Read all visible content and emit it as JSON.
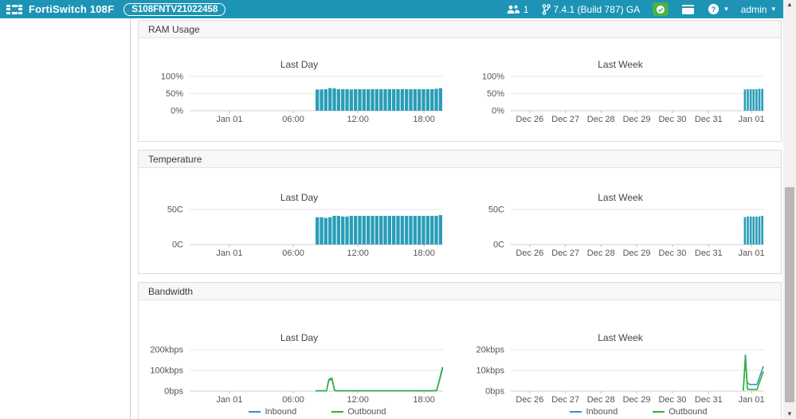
{
  "header": {
    "product": "FortiSwitch 108F",
    "serial": "S108FNTV21022458",
    "user_count": "1",
    "version": "7.4.1 (Build 787) GA",
    "admin_label": "admin",
    "colors": {
      "navbar_bg": "#1d94b6",
      "status_badge_bg": "#4db04a"
    }
  },
  "panels": [
    {
      "title": "RAM Usage"
    },
    {
      "title": "Temperature"
    },
    {
      "title": "Bandwidth"
    }
  ],
  "colors": {
    "bar_fill": "#2a9db8",
    "gridline": "#e7e7e7",
    "axis": "#cfcfcf",
    "tick": "#bbbbbb",
    "tick_text": "#555555",
    "inbound": "#2997cc",
    "outbound": "#2eb42e"
  },
  "chart_data": [
    {
      "id": "ram-day",
      "panel": "RAM Usage",
      "type": "bar",
      "title": "Last Day",
      "ylim": [
        0,
        100
      ],
      "y_ticks": [
        {
          "label": "0%",
          "v": 0
        },
        {
          "label": "50%",
          "v": 50
        },
        {
          "label": "100%",
          "v": 100
        }
      ],
      "x_ticks": [
        {
          "label": "Jan 01",
          "f": 0.157
        },
        {
          "label": "06:00",
          "f": 0.409
        },
        {
          "label": "12:00",
          "f": 0.664
        },
        {
          "label": "18:00",
          "f": 0.925
        }
      ],
      "bars": {
        "x_start": 0.497,
        "x_end": 1.0,
        "values": [
          62,
          62,
          63,
          66,
          65,
          63,
          63,
          63,
          62,
          63,
          63,
          63,
          63,
          63,
          63,
          63,
          63,
          63,
          63,
          63,
          63,
          63,
          63,
          63,
          63,
          63,
          63,
          63,
          64,
          66
        ]
      }
    },
    {
      "id": "ram-week",
      "panel": "RAM Usage",
      "type": "bar",
      "title": "Last Week",
      "ylim": [
        0,
        100
      ],
      "y_ticks": [
        {
          "label": "0%",
          "v": 0
        },
        {
          "label": "50%",
          "v": 50
        },
        {
          "label": "100%",
          "v": 100
        }
      ],
      "x_ticks": [
        {
          "label": "Dec 26",
          "f": 0.075
        },
        {
          "label": "Dec 27",
          "f": 0.216
        },
        {
          "label": "Dec 28",
          "f": 0.356
        },
        {
          "label": "Dec 29",
          "f": 0.497
        },
        {
          "label": "Dec 30",
          "f": 0.638
        },
        {
          "label": "Dec 31",
          "f": 0.781
        },
        {
          "label": "Jan 01",
          "f": 0.95
        }
      ],
      "bars": {
        "x_start": 0.92,
        "x_end": 1.0,
        "values": [
          62,
          63,
          63,
          63,
          63,
          64,
          64
        ]
      }
    },
    {
      "id": "temp-day",
      "panel": "Temperature",
      "type": "bar",
      "title": "Last Day",
      "ylim": [
        0,
        50
      ],
      "y_ticks": [
        {
          "label": "0C",
          "v": 0
        },
        {
          "label": "50C",
          "v": 50
        }
      ],
      "x_ticks": [
        {
          "label": "Jan 01",
          "f": 0.157
        },
        {
          "label": "06:00",
          "f": 0.409
        },
        {
          "label": "12:00",
          "f": 0.664
        },
        {
          "label": "18:00",
          "f": 0.925
        }
      ],
      "bars": {
        "x_start": 0.497,
        "x_end": 1.0,
        "values": [
          39,
          39,
          38,
          39,
          41,
          41,
          40,
          40,
          41,
          41,
          41,
          41,
          41,
          41,
          41,
          41,
          41,
          41,
          41,
          41,
          41,
          41,
          41,
          41,
          41,
          41,
          41,
          41,
          41,
          42
        ]
      }
    },
    {
      "id": "temp-week",
      "panel": "Temperature",
      "type": "bar",
      "title": "Last Week",
      "ylim": [
        0,
        50
      ],
      "y_ticks": [
        {
          "label": "0C",
          "v": 0
        },
        {
          "label": "50C",
          "v": 50
        }
      ],
      "x_ticks": [
        {
          "label": "Dec 26",
          "f": 0.075
        },
        {
          "label": "Dec 27",
          "f": 0.216
        },
        {
          "label": "Dec 28",
          "f": 0.356
        },
        {
          "label": "Dec 29",
          "f": 0.497
        },
        {
          "label": "Dec 30",
          "f": 0.638
        },
        {
          "label": "Dec 31",
          "f": 0.781
        },
        {
          "label": "Jan 01",
          "f": 0.95
        }
      ],
      "bars": {
        "x_start": 0.92,
        "x_end": 1.0,
        "values": [
          39,
          40,
          40,
          40,
          40,
          40,
          41
        ]
      }
    },
    {
      "id": "bw-day",
      "panel": "Bandwidth",
      "type": "line",
      "title": "Last Day",
      "ylim": [
        0,
        200
      ],
      "y_unit": "kbps",
      "y_ticks": [
        {
          "label": "0bps",
          "v": 0
        },
        {
          "label": "100kbps",
          "v": 100
        },
        {
          "label": "200kbps",
          "v": 200
        }
      ],
      "x_ticks": [
        {
          "label": "Jan 01",
          "f": 0.157
        },
        {
          "label": "06:00",
          "f": 0.409
        },
        {
          "label": "12:00",
          "f": 0.664
        },
        {
          "label": "18:00",
          "f": 0.925
        }
      ],
      "legend": [
        {
          "name": "Inbound",
          "color": "#2997cc"
        },
        {
          "name": "Outbound",
          "color": "#2eb42e"
        }
      ],
      "series": [
        {
          "name": "Inbound",
          "color": "#2997cc",
          "points": [
            [
              0.497,
              1.2
            ],
            [
              0.54,
              1.2
            ],
            [
              0.549,
              50
            ],
            [
              0.556,
              56
            ],
            [
              0.562,
              56
            ],
            [
              0.572,
              3
            ],
            [
              0.582,
              1.2
            ],
            [
              0.95,
              1.2
            ],
            [
              0.975,
              2
            ],
            [
              0.998,
              108
            ]
          ]
        },
        {
          "name": "Outbound",
          "color": "#2eb42e",
          "points": [
            [
              0.497,
              2
            ],
            [
              0.54,
              2
            ],
            [
              0.549,
              55
            ],
            [
              0.556,
              62
            ],
            [
              0.562,
              62
            ],
            [
              0.572,
              4
            ],
            [
              0.582,
              2
            ],
            [
              0.95,
              2
            ],
            [
              0.975,
              3
            ],
            [
              0.998,
              116
            ]
          ]
        }
      ]
    },
    {
      "id": "bw-week",
      "panel": "Bandwidth",
      "type": "line",
      "title": "Last Week",
      "ylim": [
        0,
        20
      ],
      "y_unit": "kbps",
      "y_ticks": [
        {
          "label": "0bps",
          "v": 0
        },
        {
          "label": "10kbps",
          "v": 10
        },
        {
          "label": "20kbps",
          "v": 20
        }
      ],
      "x_ticks": [
        {
          "label": "Dec 26",
          "f": 0.075
        },
        {
          "label": "Dec 27",
          "f": 0.216
        },
        {
          "label": "Dec 28",
          "f": 0.356
        },
        {
          "label": "Dec 29",
          "f": 0.497
        },
        {
          "label": "Dec 30",
          "f": 0.638
        },
        {
          "label": "Dec 31",
          "f": 0.781
        },
        {
          "label": "Jan 01",
          "f": 0.95
        }
      ],
      "legend": [
        {
          "name": "Inbound",
          "color": "#2997cc"
        },
        {
          "name": "Outbound",
          "color": "#2eb42e"
        }
      ],
      "series": [
        {
          "name": "Inbound",
          "color": "#2997cc",
          "points": [
            [
              0.918,
              0.3
            ],
            [
              0.926,
              17.5
            ],
            [
              0.933,
              4
            ],
            [
              0.944,
              3.2
            ],
            [
              0.972,
              3.2
            ],
            [
              0.997,
              12
            ]
          ]
        },
        {
          "name": "Outbound",
          "color": "#2eb42e",
          "points": [
            [
              0.918,
              0.3
            ],
            [
              0.926,
              16
            ],
            [
              0.934,
              1
            ],
            [
              0.944,
              0.8
            ],
            [
              0.972,
              0.8
            ],
            [
              0.997,
              9.5
            ]
          ]
        }
      ]
    }
  ]
}
